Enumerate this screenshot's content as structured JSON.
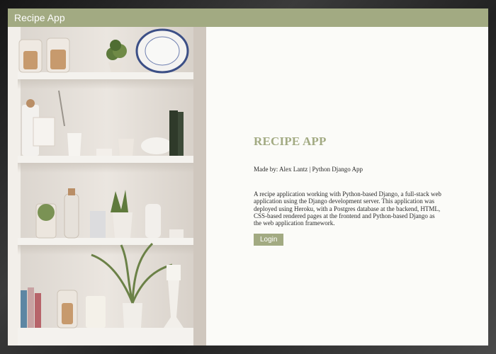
{
  "navbar": {
    "brand": "Recipe App"
  },
  "hero_image": {
    "subject": "white-shelves-with-jars-and-plants"
  },
  "main": {
    "title": "RECIPE APP",
    "author_line": "Made by: Alex Lantz | Python Django App",
    "description": "A recipe application working with Python-based Django, a full-stack web application using the Django development server. This application was deployed using Heroku, with a Postgres database at the backend, HTML, CSS-based rendered pages at the frontend and Python-based Django as the web application framework.",
    "login_label": "Login"
  },
  "colors": {
    "accent": "#a2aa82",
    "background": "#fbfbf8",
    "text": "#2a2a2a"
  }
}
